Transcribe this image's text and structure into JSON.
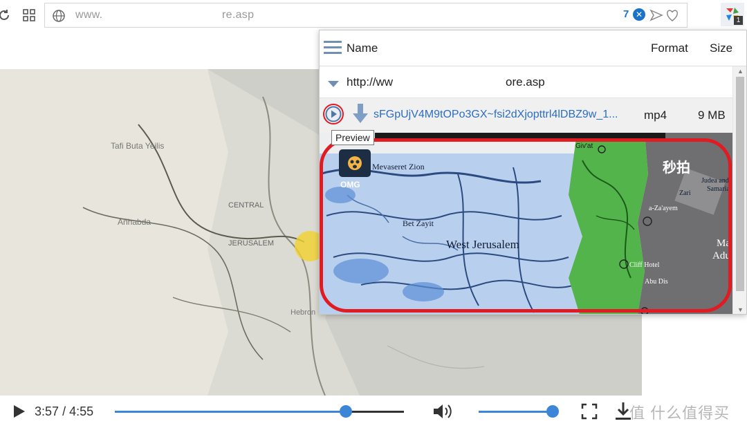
{
  "toolbar": {
    "reload_icon": "reload-icon",
    "grid_icon": "grid-icon",
    "address_prefix": "www.",
    "address_suffix": "re.asp",
    "extension_count": "7",
    "extension_badge": "1"
  },
  "popup": {
    "columns": {
      "name": "Name",
      "format": "Format",
      "size": "Size"
    },
    "page_url_prefix": "http://ww",
    "page_url_suffix": "ore.asp",
    "media": {
      "file_name": "sFGpUjV4M9tOPo3GX~fsi2dXjopttrl4lDBZ9w_1...",
      "format": "mp4",
      "size": "9 MB"
    },
    "tooltip": "Preview",
    "thumbnail": {
      "app_label": "OMG",
      "watermark": "秒拍",
      "labels": {
        "mevaseret": "Mevaseret Zion",
        "bet_zayit": "Bet Zayit",
        "west_jerusalem": "West Jerusalem",
        "judea": "Judea and",
        "samaria": "Samaria",
        "zarim": "Zari",
        "ma": "Ma",
        "adu": "Adu",
        "a_zalam": "a-Za'ayem",
        "cliff_hotel": "Cliff Hotel",
        "abu_dis": "Abu Dis"
      }
    }
  },
  "player": {
    "current_time": "3:57",
    "duration": "4:55",
    "progress_fraction": 0.8,
    "volume_fraction": 1.0,
    "site_watermark": "值 什么值得买"
  },
  "colors": {
    "accent": "#3b86d7",
    "highlight": "#e11b22",
    "link": "#2b6dc2"
  }
}
